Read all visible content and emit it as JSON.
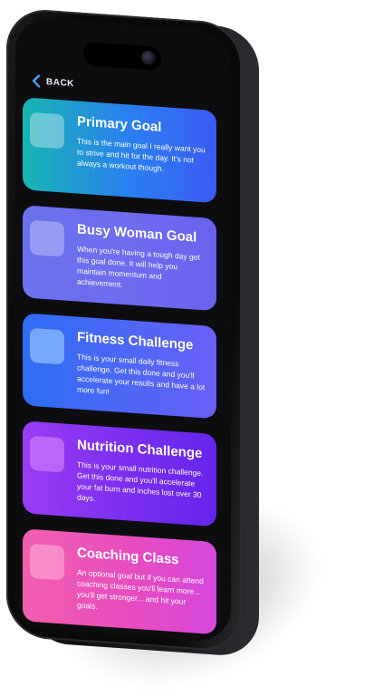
{
  "header": {
    "back_label": "BACK"
  },
  "cards": [
    {
      "title": "Primary Goal",
      "description": "This is the main goal I really want you to strive and hit for the day. It's not always a workout though."
    },
    {
      "title": "Busy Woman Goal",
      "description": "When you're having a tough day get this goal done. It will help you maintain momentum and achievement."
    },
    {
      "title": "Fitness Challenge",
      "description": "This is your small daily fitness challenge. Get this done and you'll accelerate your results and have a lot more fun!"
    },
    {
      "title": "Nutrition Challenge",
      "description": "This is your small nutrition challenge. Get this done and you'll accelerate your fat burn and inches lost over 30 days."
    },
    {
      "title": "Coaching Class",
      "description": "An optional goal but if you can attend coaching classes you'll learn more... you'll get stronger... and hit your goals."
    }
  ],
  "colors": {
    "screen_background": "#0d0d10",
    "primary_goal": "#2a7ff0",
    "busy_woman_goal": "#6f6cf0",
    "fitness_challenge": "#4d67f6",
    "nutrition_challenge": "#7a2ff0",
    "coaching_class": "#e74dbf"
  },
  "icons": {
    "back": "chevron-left-icon",
    "camera": "front-camera-icon"
  }
}
